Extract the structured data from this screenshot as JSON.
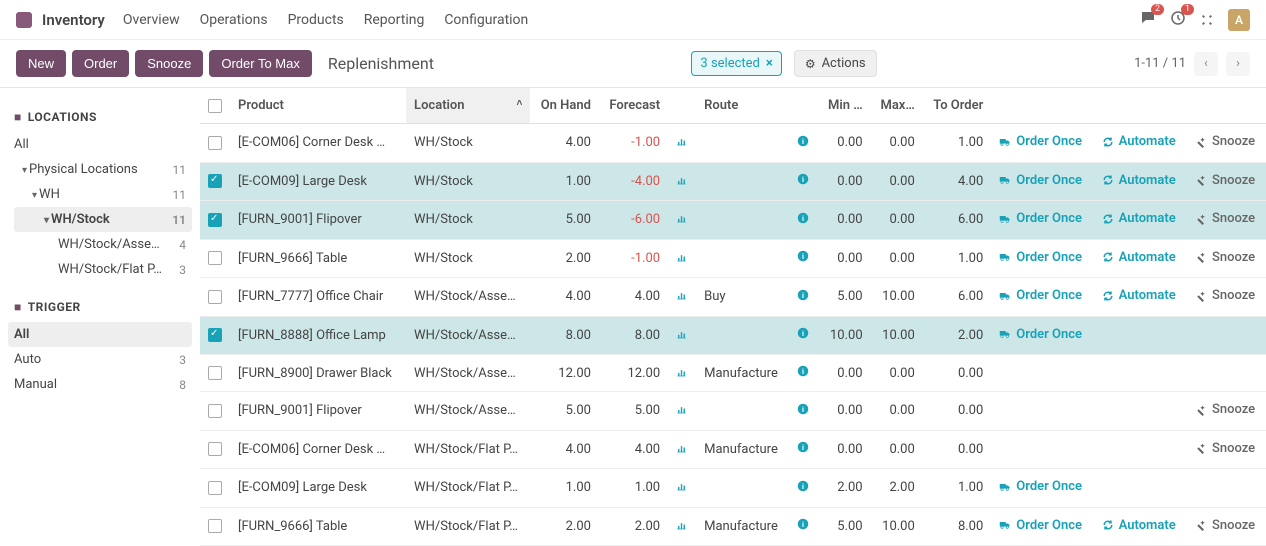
{
  "topbar": {
    "app_name": "Inventory",
    "menu": [
      "Overview",
      "Operations",
      "Products",
      "Reporting",
      "Configuration"
    ],
    "msg_badge": "2",
    "clock_badge": "1",
    "avatar_letter": "A"
  },
  "controlbar": {
    "buttons": {
      "new": "New",
      "order": "Order",
      "snooze": "Snooze",
      "order_to_max": "Order To Max"
    },
    "crumb": "Replenishment",
    "selected_label": "3 selected",
    "actions_label": "Actions",
    "pager_text": "1-11 / 11"
  },
  "sidebar": {
    "locations_heading": "LOCATIONS",
    "all_label": "All",
    "phys_label": "Physical Locations",
    "phys_cnt": "11",
    "wh_label": "WH",
    "wh_cnt": "11",
    "whstock_label": "WH/Stock",
    "whstock_cnt": "11",
    "asse_label": "WH/Stock/Asse…",
    "asse_cnt": "4",
    "flat_label": "WH/Stock/Flat P…",
    "flat_cnt": "3",
    "trigger_heading": "TRIGGER",
    "trig_all": "All",
    "trig_auto": "Auto",
    "trig_auto_cnt": "3",
    "trig_manual": "Manual",
    "trig_manual_cnt": "8"
  },
  "columns": {
    "product": "Product",
    "location": "Location",
    "onhand": "On Hand",
    "forecast": "Forecast",
    "route": "Route",
    "min": "Min …",
    "max": "Max…",
    "toorder": "To Order"
  },
  "action_labels": {
    "order_once": "Order Once",
    "automate": "Automate",
    "snooze": "Snooze"
  },
  "rows": [
    {
      "sel": false,
      "product": "[E-COM06] Corner Desk …",
      "location": "WH/Stock",
      "onhand": "4.00",
      "forecast": "-1.00",
      "fneg": true,
      "route": "",
      "min": "0.00",
      "max": "0.00",
      "toorder": "1.00",
      "actions": [
        "order_once",
        "automate",
        "snooze"
      ]
    },
    {
      "sel": true,
      "product": "[E-COM09] Large Desk",
      "location": "WH/Stock",
      "onhand": "1.00",
      "forecast": "-4.00",
      "fneg": true,
      "route": "",
      "min": "0.00",
      "max": "0.00",
      "toorder": "4.00",
      "actions": [
        "order_once",
        "automate",
        "snooze"
      ]
    },
    {
      "sel": true,
      "product": "[FURN_9001] Flipover",
      "location": "WH/Stock",
      "onhand": "5.00",
      "forecast": "-6.00",
      "fneg": true,
      "route": "",
      "min": "0.00",
      "max": "0.00",
      "toorder": "6.00",
      "actions": [
        "order_once",
        "automate",
        "snooze"
      ]
    },
    {
      "sel": false,
      "product": "[FURN_9666] Table",
      "location": "WH/Stock",
      "onhand": "2.00",
      "forecast": "-1.00",
      "fneg": true,
      "route": "",
      "min": "0.00",
      "max": "0.00",
      "toorder": "1.00",
      "actions": [
        "order_once",
        "automate",
        "snooze"
      ]
    },
    {
      "sel": false,
      "product": "[FURN_7777] Office Chair",
      "location": "WH/Stock/Asse…",
      "onhand": "4.00",
      "forecast": "4.00",
      "fneg": false,
      "route": "Buy",
      "min": "5.00",
      "max": "10.00",
      "toorder": "6.00",
      "actions": [
        "order_once",
        "automate",
        "snooze"
      ]
    },
    {
      "sel": true,
      "product": "[FURN_8888] Office Lamp",
      "location": "WH/Stock/Asse…",
      "onhand": "8.00",
      "forecast": "8.00",
      "fneg": false,
      "route": "",
      "min": "10.00",
      "max": "10.00",
      "toorder": "2.00",
      "actions": [
        "order_once"
      ]
    },
    {
      "sel": false,
      "product": "[FURN_8900] Drawer Black",
      "location": "WH/Stock/Asse…",
      "onhand": "12.00",
      "forecast": "12.00",
      "fneg": false,
      "route": "Manufacture",
      "min": "0.00",
      "max": "0.00",
      "toorder": "0.00",
      "actions": []
    },
    {
      "sel": false,
      "product": "[FURN_9001] Flipover",
      "location": "WH/Stock/Asse…",
      "onhand": "5.00",
      "forecast": "5.00",
      "fneg": false,
      "route": "",
      "min": "0.00",
      "max": "0.00",
      "toorder": "0.00",
      "actions": [
        "snooze"
      ]
    },
    {
      "sel": false,
      "product": "[E-COM06] Corner Desk …",
      "location": "WH/Stock/Flat P…",
      "onhand": "4.00",
      "forecast": "4.00",
      "fneg": false,
      "route": "Manufacture",
      "min": "0.00",
      "max": "0.00",
      "toorder": "0.00",
      "actions": [
        "snooze"
      ]
    },
    {
      "sel": false,
      "product": "[E-COM09] Large Desk",
      "location": "WH/Stock/Flat P…",
      "onhand": "1.00",
      "forecast": "1.00",
      "fneg": false,
      "route": "",
      "min": "2.00",
      "max": "2.00",
      "toorder": "1.00",
      "actions": [
        "order_once"
      ]
    },
    {
      "sel": false,
      "product": "[FURN_9666] Table",
      "location": "WH/Stock/Flat P…",
      "onhand": "2.00",
      "forecast": "2.00",
      "fneg": false,
      "route": "Manufacture",
      "min": "5.00",
      "max": "10.00",
      "toorder": "8.00",
      "actions": [
        "order_once",
        "automate",
        "snooze"
      ]
    }
  ]
}
